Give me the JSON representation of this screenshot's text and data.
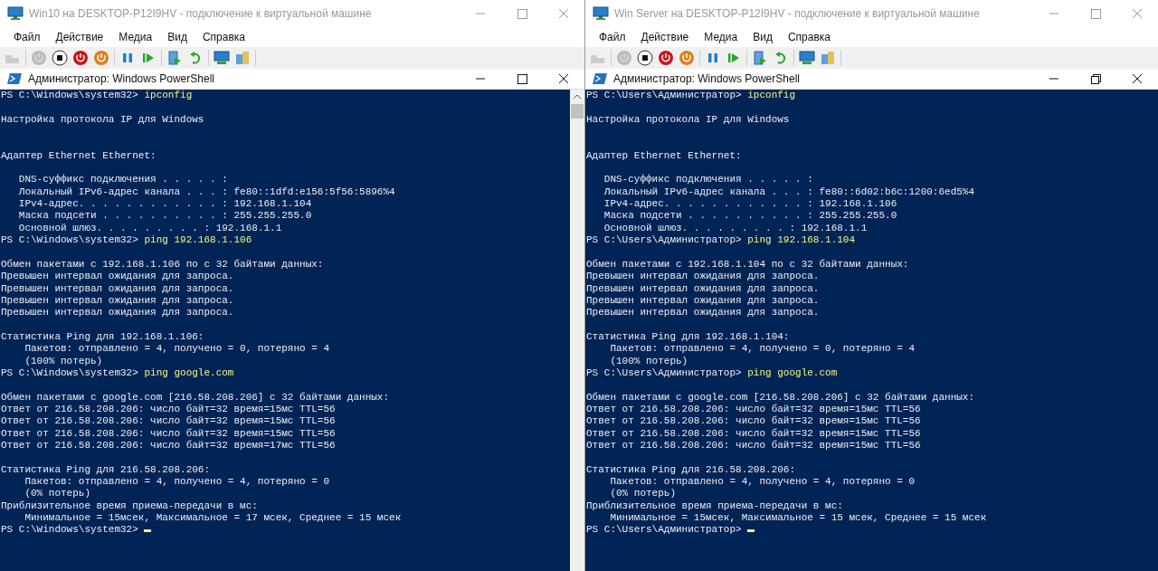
{
  "windows": [
    {
      "title": "Win10 на DESKTOP-P12I9HV - подключение к виртуальной машине",
      "menu": [
        "Файл",
        "Действие",
        "Медиа",
        "Вид",
        "Справка"
      ],
      "console_title": "Администратор: Windows PowerShell",
      "console_maximized": false,
      "scrollbar": true,
      "lines": [
        {
          "kind": "prompt",
          "prompt": "PS C:\\Windows\\system32>",
          "command": "ipconfig"
        },
        {
          "kind": "blank"
        },
        {
          "kind": "output",
          "text": "Настройка протокола IP для Windows"
        },
        {
          "kind": "blank"
        },
        {
          "kind": "blank"
        },
        {
          "kind": "output",
          "text": "Адаптер Ethernet Ethernet:"
        },
        {
          "kind": "blank"
        },
        {
          "kind": "output",
          "text": "   DNS-суффикс подключения . . . . . :"
        },
        {
          "kind": "output",
          "text": "   Локальный IPv6-адрес канала . . . : fe80::1dfd:e156:5f56:5896%4"
        },
        {
          "kind": "output",
          "text": "   IPv4-адрес. . . . . . . . . . . . : 192.168.1.104"
        },
        {
          "kind": "output",
          "text": "   Маска подсети . . . . . . . . . . : 255.255.255.0"
        },
        {
          "kind": "output",
          "text": "   Основной шлюз. . . . . . . . . : 192.168.1.1"
        },
        {
          "kind": "prompt",
          "prompt": "PS C:\\Windows\\system32>",
          "command": "ping 192.168.1.106"
        },
        {
          "kind": "blank"
        },
        {
          "kind": "output",
          "text": "Обмен пакетами с 192.168.1.106 по с 32 байтами данных:"
        },
        {
          "kind": "output",
          "text": "Превышен интервал ожидания для запроса."
        },
        {
          "kind": "output",
          "text": "Превышен интервал ожидания для запроса."
        },
        {
          "kind": "output",
          "text": "Превышен интервал ожидания для запроса."
        },
        {
          "kind": "output",
          "text": "Превышен интервал ожидания для запроса."
        },
        {
          "kind": "blank"
        },
        {
          "kind": "output",
          "text": "Статистика Ping для 192.168.1.106:"
        },
        {
          "kind": "output",
          "text": "    Пакетов: отправлено = 4, получено = 0, потеряно = 4"
        },
        {
          "kind": "output",
          "text": "    (100% потерь)"
        },
        {
          "kind": "prompt",
          "prompt": "PS C:\\Windows\\system32>",
          "command": "ping google.com"
        },
        {
          "kind": "blank"
        },
        {
          "kind": "output",
          "text": "Обмен пакетами с google.com [216.58.208.206] с 32 байтами данных:"
        },
        {
          "kind": "output",
          "text": "Ответ от 216.58.208.206: число байт=32 время=15мс TTL=56"
        },
        {
          "kind": "output",
          "text": "Ответ от 216.58.208.206: число байт=32 время=15мс TTL=56"
        },
        {
          "kind": "output",
          "text": "Ответ от 216.58.208.206: число байт=32 время=15мс TTL=56"
        },
        {
          "kind": "output",
          "text": "Ответ от 216.58.208.206: число байт=32 время=17мс TTL=56"
        },
        {
          "kind": "blank"
        },
        {
          "kind": "output",
          "text": "Статистика Ping для 216.58.208.206:"
        },
        {
          "kind": "output",
          "text": "    Пакетов: отправлено = 4, получено = 4, потеряно = 0"
        },
        {
          "kind": "output",
          "text": "    (0% потерь)"
        },
        {
          "kind": "output",
          "text": "Приблизительное время приема-передачи в мс:"
        },
        {
          "kind": "output",
          "text": "    Минимальное = 15мсек, Максимальное = 17 мсек, Среднее = 15 мсек"
        },
        {
          "kind": "cursor",
          "prompt": "PS C:\\Windows\\system32>"
        }
      ]
    },
    {
      "title": "Win Server на DESKTOP-P12I9HV - подключение к виртуальной машине",
      "menu": [
        "Файл",
        "Действие",
        "Медиа",
        "Вид",
        "Справка"
      ],
      "console_title": "Администратор: Windows PowerShell",
      "console_maximized": true,
      "scrollbar": false,
      "lines": [
        {
          "kind": "prompt",
          "prompt": "PS C:\\Users\\Администратор>",
          "command": "ipconfig"
        },
        {
          "kind": "blank"
        },
        {
          "kind": "output",
          "text": "Настройка протокола IP для Windows"
        },
        {
          "kind": "blank"
        },
        {
          "kind": "blank"
        },
        {
          "kind": "output",
          "text": "Адаптер Ethernet Ethernet:"
        },
        {
          "kind": "blank"
        },
        {
          "kind": "output",
          "text": "   DNS-суффикс подключения . . . . . :"
        },
        {
          "kind": "output",
          "text": "   Локальный IPv6-адрес канала . . . : fe80::6d02:b6c:1200:6ed5%4"
        },
        {
          "kind": "output",
          "text": "   IPv4-адрес. . . . . . . . . . . . : 192.168.1.106"
        },
        {
          "kind": "output",
          "text": "   Маска подсети . . . . . . . . . . : 255.255.255.0"
        },
        {
          "kind": "output",
          "text": "   Основной шлюз. . . . . . . . . : 192.168.1.1"
        },
        {
          "kind": "prompt",
          "prompt": "PS C:\\Users\\Администратор>",
          "command": "ping 192.168.1.104"
        },
        {
          "kind": "blank"
        },
        {
          "kind": "output",
          "text": "Обмен пакетами с 192.168.1.104 по с 32 байтами данных:"
        },
        {
          "kind": "output",
          "text": "Превышен интервал ожидания для запроса."
        },
        {
          "kind": "output",
          "text": "Превышен интервал ожидания для запроса."
        },
        {
          "kind": "output",
          "text": "Превышен интервал ожидания для запроса."
        },
        {
          "kind": "output",
          "text": "Превышен интервал ожидания для запроса."
        },
        {
          "kind": "blank"
        },
        {
          "kind": "output",
          "text": "Статистика Ping для 192.168.1.104:"
        },
        {
          "kind": "output",
          "text": "    Пакетов: отправлено = 4, получено = 0, потеряно = 4"
        },
        {
          "kind": "output",
          "text": "    (100% потерь)"
        },
        {
          "kind": "prompt",
          "prompt": "PS C:\\Users\\Администратор>",
          "command": "ping google.com"
        },
        {
          "kind": "blank"
        },
        {
          "kind": "output",
          "text": "Обмен пакетами с google.com [216.58.208.206] с 32 байтами данных:"
        },
        {
          "kind": "output",
          "text": "Ответ от 216.58.208.206: число байт=32 время=15мс TTL=56"
        },
        {
          "kind": "output",
          "text": "Ответ от 216.58.208.206: число байт=32 время=15мс TTL=56"
        },
        {
          "kind": "output",
          "text": "Ответ от 216.58.208.206: число байт=32 время=15мс TTL=56"
        },
        {
          "kind": "output",
          "text": "Ответ от 216.58.208.206: число байт=32 время=15мс TTL=56"
        },
        {
          "kind": "blank"
        },
        {
          "kind": "output",
          "text": "Статистика Ping для 216.58.208.206:"
        },
        {
          "kind": "output",
          "text": "    Пакетов: отправлено = 4, получено = 4, потеряно = 0"
        },
        {
          "kind": "output",
          "text": "    (0% потерь)"
        },
        {
          "kind": "output",
          "text": "Приблизительное время приема-передачи в мс:"
        },
        {
          "kind": "output",
          "text": "    Минимальное = 15мсек, Максимальное = 15 мсек, Среднее = 15 мсек"
        },
        {
          "kind": "cursor",
          "prompt": "PS C:\\Users\\Администратор>"
        }
      ]
    }
  ]
}
